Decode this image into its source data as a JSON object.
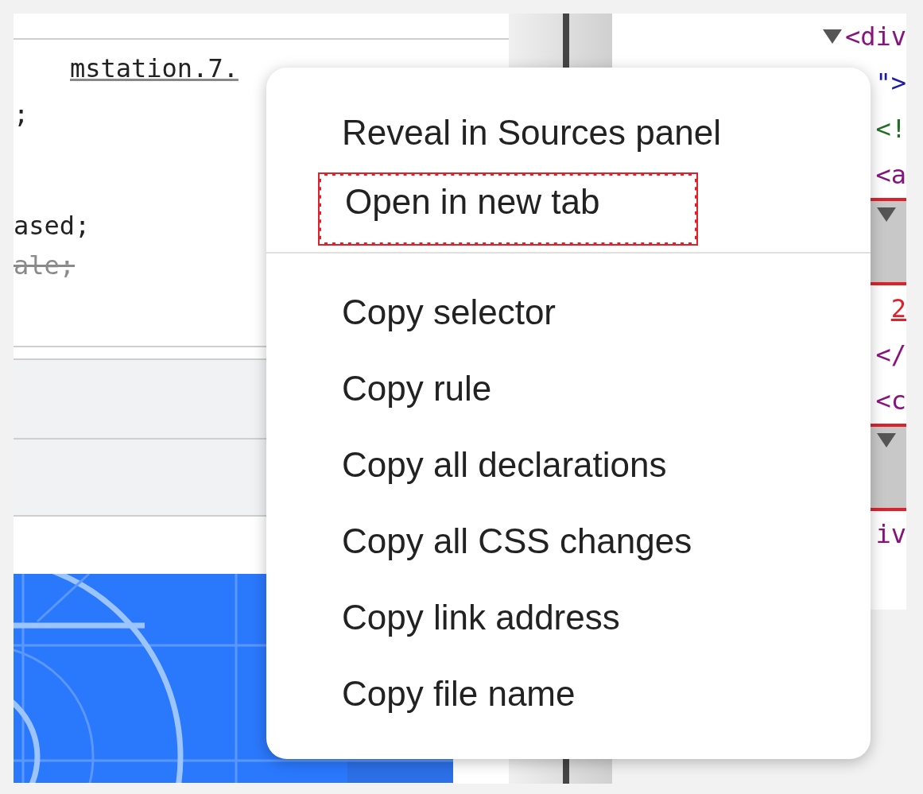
{
  "styles_panel": {
    "source_link": "mstation.7.",
    "lines": [
      {
        "text": ";",
        "struck": false
      },
      {
        "text": "ased;",
        "struck": false
      },
      {
        "text": "ale;",
        "struck": true
      }
    ]
  },
  "elements_panel": {
    "rows": [
      {
        "kind": "tag",
        "text": "<div",
        "triangle": true
      },
      {
        "kind": "attr",
        "text": "\">",
        "triangle": false
      },
      {
        "kind": "comment",
        "text": "<!",
        "triangle": false
      },
      {
        "kind": "tag",
        "text": "<a",
        "triangle": false
      },
      {
        "kind": "bar",
        "text": "",
        "triangle": true
      },
      {
        "kind": "number",
        "text": "2",
        "triangle": false
      },
      {
        "kind": "tag",
        "text": "</",
        "triangle": false
      },
      {
        "kind": "tag",
        "text": "<c",
        "triangle": false
      },
      {
        "kind": "bar",
        "text": "",
        "triangle": true
      },
      {
        "kind": "tag",
        "text": "iv",
        "triangle": false
      }
    ]
  },
  "context_menu": {
    "groups": [
      [
        {
          "label": "Reveal in Sources panel",
          "highlighted": false
        },
        {
          "label": "Open in new tab",
          "highlighted": true
        }
      ],
      [
        {
          "label": "Copy selector",
          "highlighted": false
        },
        {
          "label": "Copy rule",
          "highlighted": false
        },
        {
          "label": "Copy all declarations",
          "highlighted": false
        },
        {
          "label": "Copy all CSS changes",
          "highlighted": false
        },
        {
          "label": "Copy link address",
          "highlighted": false
        },
        {
          "label": "Copy file name",
          "highlighted": false
        }
      ]
    ]
  }
}
